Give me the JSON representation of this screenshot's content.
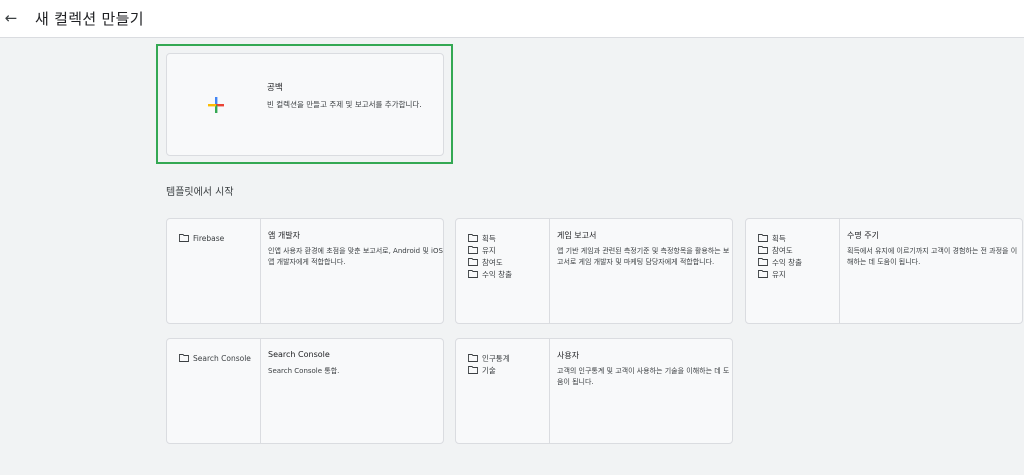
{
  "header": {
    "back_icon": "arrow-left-icon",
    "back_glyph": "←",
    "title": "새 컬렉션 만들기"
  },
  "blank": {
    "icon": "plus-icon",
    "title": "공백",
    "description": "빈 컬렉션을 만들고 주제 및 보고서를 추가합니다."
  },
  "templates_section": {
    "title": "템플릿에서 시작"
  },
  "templates": [
    {
      "folders": [
        "Firebase"
      ],
      "title": "앱 개발자",
      "description": "인앱 사용자 환경에 초점을 맞춘 보고서로, Android 및 iOS 앱 개발자에게 적합합니다."
    },
    {
      "folders": [
        "획득",
        "유지",
        "참여도",
        "수익 창출"
      ],
      "title": "게임 보고서",
      "description": "앱 기반 게임과 관련된 측정기준 및 측정항목을 활용하는 보고서로 게임 개발자 및 마케팅 담당자에게 적합합니다."
    },
    {
      "folders": [
        "획득",
        "참여도",
        "수익 창출",
        "유지"
      ],
      "title": "수명 주기",
      "description": "획득에서 유지에 이르기까지 고객이 경험하는 전 과정을 이해하는 데 도움이 됩니다."
    },
    {
      "folders": [
        "Search Console"
      ],
      "title": "Search Console",
      "description": "Search Console 통합."
    },
    {
      "folders": [
        "인구통계",
        "기술"
      ],
      "title": "사용자",
      "description": "고객의 인구통계 및 고객이 사용하는 기술을 이해하는 데 도움이 됩니다."
    }
  ],
  "colors": {
    "selected_outline": "#34a853",
    "plus_blue": "#4285f4",
    "plus_red": "#ea4335",
    "plus_yellow": "#fbbc04",
    "plus_green": "#34a853"
  }
}
